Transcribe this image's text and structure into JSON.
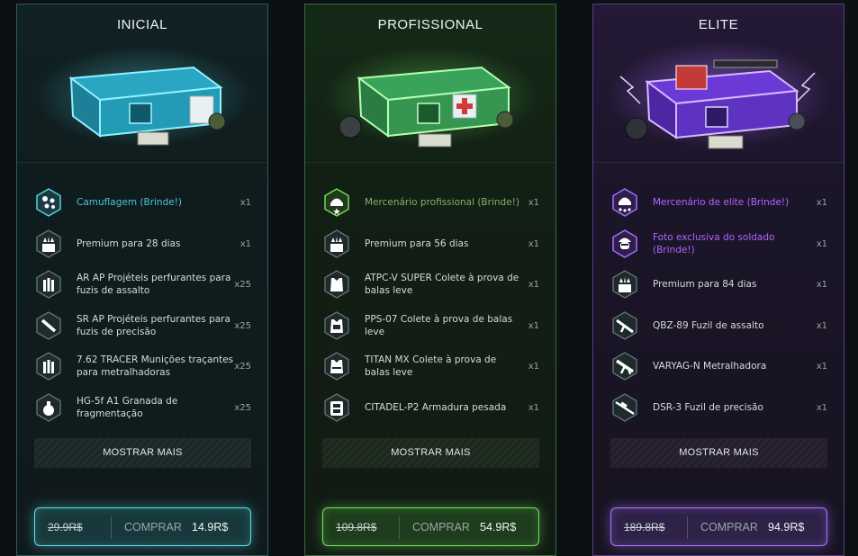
{
  "packages": [
    {
      "key": "inicial",
      "title": "INICIAL",
      "accent": "#4fd6e0",
      "items": [
        {
          "name": "Camuflagem (Brinde!)",
          "qty": "x1",
          "icon": "camo-icon",
          "highlight": true
        },
        {
          "name": "Premium para 28 dias",
          "qty": "x1",
          "icon": "premium-icon"
        },
        {
          "name": "AR AP Projéteis perfurantes para fuzis de assalto",
          "qty": "x25",
          "icon": "bullets-icon"
        },
        {
          "name": "SR AP Projéteis perfurantes para fuzis de precisão",
          "qty": "x25",
          "icon": "sniper-bullet-icon"
        },
        {
          "name": "7.62 TRACER Munições traçantes para metralhadoras",
          "qty": "x25",
          "icon": "bullets-icon"
        },
        {
          "name": "HG-5f A1 Granada de fragmentação",
          "qty": "x25",
          "icon": "grenade-icon"
        }
      ],
      "more_label": "MOSTRAR MAIS",
      "old_price": "29.9R$",
      "buy_label": "COMPRAR",
      "price": "14.9R$"
    },
    {
      "key": "profissional",
      "title": "PROFISSIONAL",
      "accent": "#6fdc5a",
      "items": [
        {
          "name": "Mercenário profissional (Brinde!)",
          "qty": "x1",
          "icon": "mercenary-icon",
          "highlight": true
        },
        {
          "name": "Premium para 56 dias",
          "qty": "x1",
          "icon": "premium-icon"
        },
        {
          "name": "ATPC-V SUPER Colete à prova de balas leve",
          "qty": "x1",
          "icon": "vest-icon"
        },
        {
          "name": "PPS-07 Colete à prova de balas leve",
          "qty": "x1",
          "icon": "vest-icon"
        },
        {
          "name": "TITAN MX Colete à prova de balas leve",
          "qty": "x1",
          "icon": "vest-icon"
        },
        {
          "name": "CITADEL-P2 Armadura pesada",
          "qty": "x1",
          "icon": "heavy-armor-icon"
        }
      ],
      "more_label": "MOSTRAR MAIS",
      "old_price": "109.8R$",
      "buy_label": "COMPRAR",
      "price": "54.9R$"
    },
    {
      "key": "elite",
      "title": "ELITE",
      "accent": "#a86bff",
      "items": [
        {
          "name": "Mercenário de elite (Brinde!)",
          "qty": "x1",
          "icon": "elite-mercenary-icon",
          "highlight": true
        },
        {
          "name": "Foto exclusiva do soldado (Brinde!)",
          "qty": "x1",
          "icon": "soldier-photo-icon",
          "highlight": true
        },
        {
          "name": "Premium para 84 dias",
          "qty": "x1",
          "icon": "premium-icon"
        },
        {
          "name": "QBZ-89 Fuzil de assalto",
          "qty": "x1",
          "icon": "rifle-icon"
        },
        {
          "name": "VARYAG-N Metralhadora",
          "qty": "x1",
          "icon": "machinegun-icon"
        },
        {
          "name": "DSR-3 Fuzil de precisão",
          "qty": "x1",
          "icon": "sniper-rifle-icon"
        }
      ],
      "more_label": "MOSTRAR MAIS",
      "old_price": "189.8R$",
      "buy_label": "COMPRAR",
      "price": "94.9R$"
    }
  ]
}
